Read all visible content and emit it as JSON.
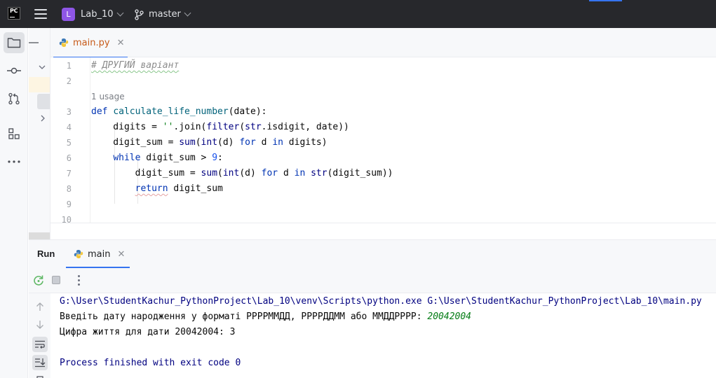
{
  "titlebar": {
    "project_badge": "L",
    "project_name": "Lab_10",
    "branch_name": "master"
  },
  "toolstrip": {
    "items": [
      "folder-icon",
      "commit-icon",
      "pull-requests-icon",
      "structure-icon",
      "more-icon"
    ]
  },
  "editor": {
    "tab_label": "main.py",
    "lines": [
      {
        "num": "1",
        "text": "# ДРУГИЙ варіант"
      },
      {
        "num": "2",
        "text": ""
      },
      {
        "num": "3",
        "text": "def calculate_life_number(date):"
      },
      {
        "num": "4",
        "text": "    digits = ''.join(filter(str.isdigit, date))"
      },
      {
        "num": "5",
        "text": "    digit_sum = sum(int(d) for d in digits)"
      },
      {
        "num": "6",
        "text": "    while digit_sum > 9:"
      },
      {
        "num": "7",
        "text": "        digit_sum = sum(int(d) for d in str(digit_sum))"
      },
      {
        "num": "8",
        "text": "        return digit_sum"
      },
      {
        "num": "9",
        "text": ""
      },
      {
        "num": "10",
        "text": ""
      }
    ],
    "usage_hint": "1 usage"
  },
  "run": {
    "title": "Run",
    "tab_label": "main",
    "console": {
      "command": "G:\\User\\StudentKachur_PythonProject\\Lab_10\\venv\\Scripts\\python.exe G:\\User\\StudentKachur_PythonProject\\Lab_10\\main.py",
      "prompt": "Введіть дату народження у форматі РРРРММДД, РРРРДДММ або ММДДРРРР: ",
      "user_input": "20042004",
      "result": "Цифра життя для дати 20042004: 3",
      "exit_message": "Process finished with exit code 0"
    }
  },
  "colors": {
    "accent": "#3574f0",
    "titlebar": "#27282c",
    "project_badge": "#8e56e6",
    "tab_label": "#c75a18"
  }
}
